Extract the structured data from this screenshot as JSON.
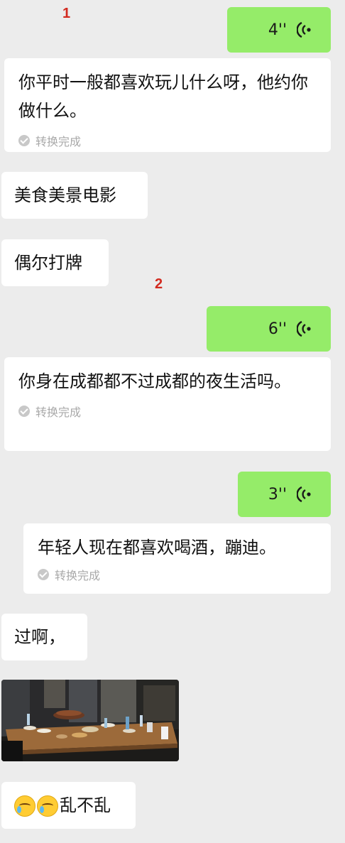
{
  "markers": [
    "1",
    "2"
  ],
  "voice_messages": [
    {
      "duration": "4''"
    },
    {
      "duration": "6''"
    },
    {
      "duration": "3''"
    }
  ],
  "transcriptions": [
    {
      "text": "你平时一般都喜欢玩儿什么呀，他约你做什么。",
      "status": "转换完成"
    },
    {
      "text": "你身在成都都不过成都的夜生活吗。",
      "status": "转换完成"
    },
    {
      "text": "年轻人现在都喜欢喝酒，蹦迪。",
      "status": "转换完成"
    }
  ],
  "replies": [
    {
      "text": "美食美景电影"
    },
    {
      "text": "偶尔打牌"
    },
    {
      "text": "过啊，"
    },
    {
      "text": "乱不乱"
    }
  ],
  "icons": {
    "voice": "voice-wave-icon",
    "status": "checkmark-circle-icon",
    "emoji": "crying-laughing-emoji-icon"
  },
  "colors": {
    "background": "#ececec",
    "sent_bubble": "#95ec69",
    "received_bubble": "#ffffff",
    "marker": "#d22a1f"
  }
}
